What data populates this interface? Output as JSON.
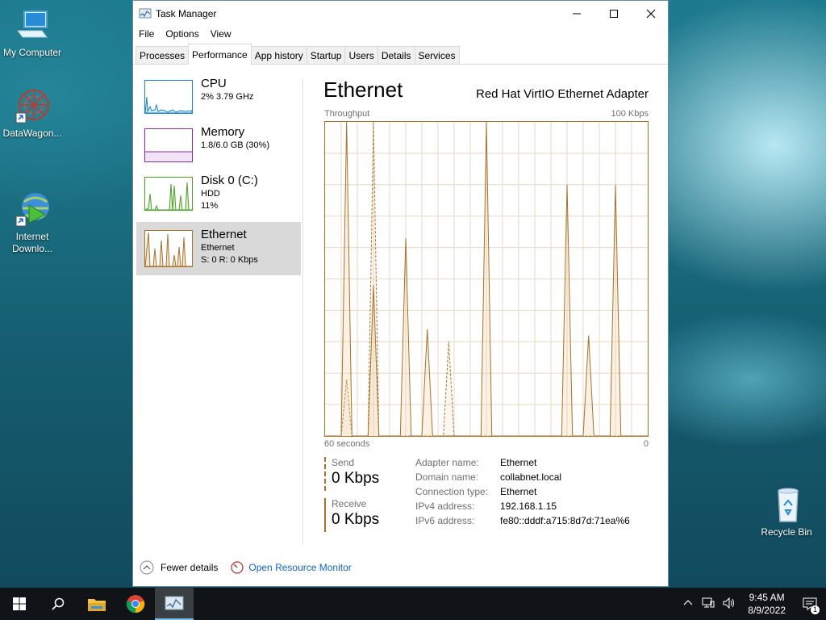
{
  "desktop": {
    "icons": [
      {
        "label": "My Computer"
      },
      {
        "label": "DataWagon..."
      },
      {
        "label": "Internet\nDownlo..."
      },
      {
        "label": "Recycle Bin"
      }
    ]
  },
  "window": {
    "title": "Task Manager",
    "menu": [
      "File",
      "Options",
      "View"
    ],
    "tabs": [
      "Processes",
      "Performance",
      "App history",
      "Startup",
      "Users",
      "Details",
      "Services"
    ],
    "active_tab": "Performance"
  },
  "sidebar": {
    "items": [
      {
        "name": "CPU",
        "line1": "2% 3.79 GHz",
        "line2": ""
      },
      {
        "name": "Memory",
        "line1": "1.8/6.0 GB (30%)",
        "line2": ""
      },
      {
        "name": "Disk 0 (C:)",
        "line1": "HDD",
        "line2": "11%"
      },
      {
        "name": "Ethernet",
        "line1": "Ethernet",
        "line2": "S: 0 R: 0 Kbps"
      }
    ]
  },
  "panel": {
    "title": "Ethernet",
    "adapter": "Red Hat VirtIO Ethernet Adapter",
    "throughput_label": "Throughput",
    "throughput_max": "100 Kbps",
    "time_left": "60 seconds",
    "time_right": "0",
    "send_label": "Send",
    "send_value": "0 Kbps",
    "receive_label": "Receive",
    "receive_value": "0 Kbps",
    "properties": [
      {
        "key": "Adapter name:",
        "value": "Ethernet"
      },
      {
        "key": "Domain name:",
        "value": "collabnet.local"
      },
      {
        "key": "Connection type:",
        "value": "Ethernet"
      },
      {
        "key": "IPv4 address:",
        "value": "192.168.1.15"
      },
      {
        "key": "IPv6 address:",
        "value": "fe80::dddf:a715:8d7d:71ea%6"
      }
    ]
  },
  "footer": {
    "fewer_details": "Fewer details",
    "open_resource_monitor": "Open Resource Monitor"
  },
  "taskbar": {
    "time": "9:45 AM",
    "date": "8/9/2022",
    "notification_count": "1"
  },
  "chart_data": {
    "type": "area",
    "title": "Throughput",
    "ylim": [
      0,
      100
    ],
    "yunit": "Kbps",
    "x_range_label": [
      "60 seconds",
      "0"
    ],
    "series": [
      {
        "name": "Send",
        "style": "dashed",
        "values": [
          0,
          0,
          0,
          0,
          18,
          0,
          0,
          0,
          0,
          100,
          0,
          0,
          0,
          0,
          0,
          0,
          0,
          0,
          0,
          0,
          0,
          0,
          0,
          30,
          0,
          0,
          0,
          0,
          0,
          0,
          0,
          0,
          0,
          0,
          0,
          0,
          0,
          0,
          0,
          0,
          0,
          0,
          0,
          0,
          0,
          0,
          0,
          0,
          0,
          0,
          0,
          0,
          0,
          0,
          0,
          0,
          0,
          0,
          0,
          0,
          0
        ]
      },
      {
        "name": "Receive",
        "style": "solid",
        "values": [
          0,
          0,
          0,
          0,
          100,
          0,
          0,
          0,
          0,
          48,
          0,
          0,
          0,
          0,
          0,
          63,
          0,
          0,
          0,
          34,
          0,
          0,
          0,
          0,
          0,
          0,
          0,
          0,
          0,
          0,
          100,
          0,
          0,
          0,
          0,
          0,
          0,
          0,
          0,
          0,
          0,
          0,
          0,
          0,
          0,
          80,
          0,
          0,
          0,
          32,
          0,
          0,
          0,
          0,
          80,
          0,
          0,
          0,
          0,
          0,
          0
        ]
      }
    ]
  }
}
